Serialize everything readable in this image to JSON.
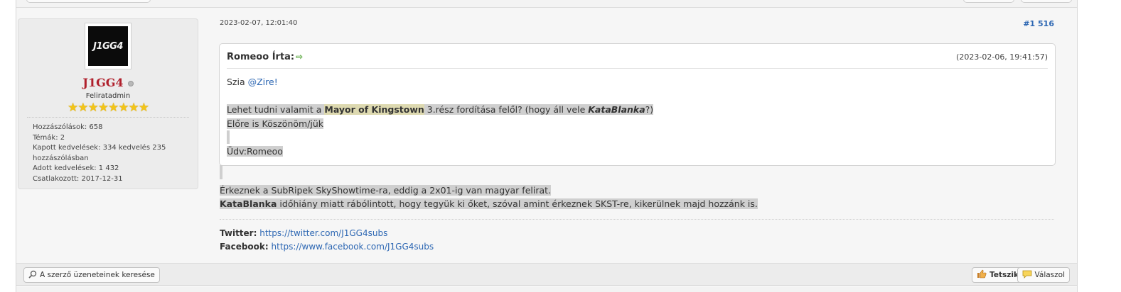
{
  "user": {
    "avatar_text": "J1GG4",
    "name": "J1GG4",
    "title": "Feliratadmin",
    "stars": "★★★★★★★★",
    "stats": [
      "Hozzászólások: 658",
      "Témák: 2",
      "Kapott kedvelések: 334 kedvelés 235 hozzászólásban",
      "Adott kedvelések: 1 432",
      "Csatlakozott: 2017-12-31"
    ]
  },
  "post": {
    "date": "2023-02-07, 12:01:40",
    "number": "#1 516"
  },
  "quote": {
    "author": "Romeoo Írta:",
    "arrow": "⇨",
    "date": "(2023-02-06, 19:41:57)",
    "greeting": "Szia ",
    "mention": "@Zire!",
    "line1_a": "Lehet tudni valamit a ",
    "line1_b": "Mayor of Kingstown",
    "line1_c": " 3.rész fordítása felől? (hogy áll vele ",
    "line1_d": "KataBlanka",
    "line1_e": "?)",
    "line2": "Előre is Köszönöm/jük",
    "line3": "Üdv:Romeoo"
  },
  "message": {
    "line1": "Érkeznek a SubRipek SkyShowtime-ra, eddig a 2x01-ig van magyar felirat.",
    "line2_bold": "KataBlanka",
    "line2_rest": " időhiány miatt rábólintott, hogy tegyük ki őket, szóval amint érkeznek SKST-re, kikerülnek majd hozzánk is."
  },
  "signature": {
    "twitter_label": "Twitter:",
    "twitter_url": "https://twitter.com/J1GG4subs",
    "facebook_label": "Facebook:",
    "facebook_url": "https://www.facebook.com/J1GG4subs"
  },
  "footer": {
    "search_label": "A szerző üzeneteinek keresése",
    "like_label": "Tetszik",
    "reply_label": "Válaszol"
  },
  "icons": {
    "search": "magnifier-icon",
    "like": "thumbs-up-icon",
    "reply": "speech-bubble-icon"
  }
}
